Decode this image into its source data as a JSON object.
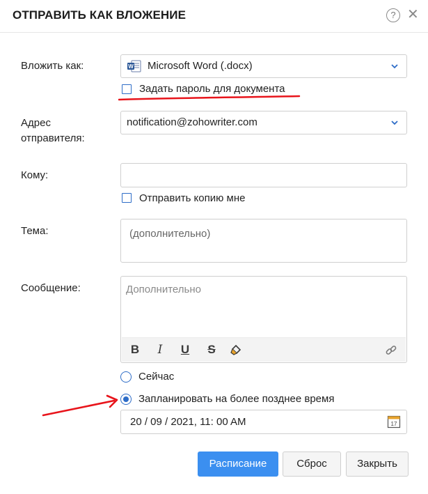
{
  "dialog": {
    "title": "ОТПРАВИТЬ КАК ВЛОЖЕНИЕ",
    "help_icon": "question-circle-icon",
    "close_icon": "close-icon",
    "close_glyph": "✕",
    "help_glyph": "?"
  },
  "attach_as": {
    "label": "Вложить как:",
    "value": "Microsoft Word (.docx)",
    "icon": "word-document-icon"
  },
  "set_password": {
    "label": "Задать пароль для документа",
    "checked": false
  },
  "sender": {
    "label_line1": "Адрес",
    "label_line2": "отправителя:",
    "value": "notification@zohowriter.com"
  },
  "to": {
    "label": "Кому:",
    "value": ""
  },
  "send_copy": {
    "label": "Отправить копию мне",
    "checked": false
  },
  "subject": {
    "label": "Тема:",
    "placeholder": "(дополнительно)"
  },
  "message": {
    "label": "Сообщение:",
    "placeholder": "Дополнительно",
    "toolbar": {
      "bold": "B",
      "italic": "I",
      "underline": "U",
      "strike": "S"
    }
  },
  "timing": {
    "now_label": "Сейчас",
    "later_label": "Запланировать на более позднее время",
    "selected": "later",
    "datetime": "20 / 09 / 2021, 11: 00 AM",
    "calendar_day": "17"
  },
  "buttons": {
    "schedule": "Расписание",
    "reset": "Сброс",
    "close": "Закрыть"
  },
  "colors": {
    "primary": "#3b8ff0",
    "accent": "#2d6cc7",
    "annotation": "#e8141b"
  }
}
